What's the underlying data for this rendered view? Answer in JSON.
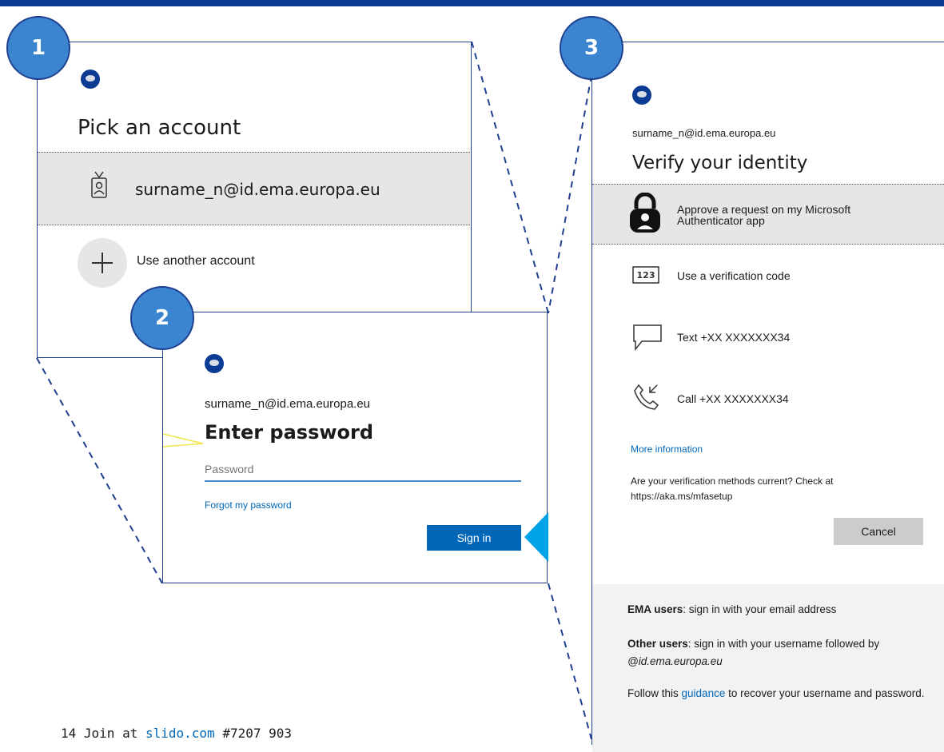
{
  "colors": {
    "brand": "#0b3b93",
    "badge": "#3b84cf",
    "link": "#0067b8",
    "accent": "#00a2e8"
  },
  "badges": [
    "1",
    "2",
    "3"
  ],
  "pick_account": {
    "title": "Pick an account",
    "account_email": "surname_n@id.ema.europa.eu",
    "use_another": "Use another account",
    "icons": {
      "account": "id-badge-icon",
      "add": "plus-icon"
    }
  },
  "enter_password": {
    "email": "surname_n@id.ema.europa.eu",
    "title": "Enter password",
    "password_placeholder": "Password",
    "forgot_link": "Forgot my password",
    "sign_in": "Sign in"
  },
  "verify_identity": {
    "email": "surname_n@id.ema.europa.eu",
    "title": "Verify your identity",
    "options": [
      {
        "icon": "lock-icon",
        "label": "Approve a request on my Microsoft Authenticator app",
        "selected": true
      },
      {
        "icon": "code-123-icon",
        "label": "Use a verification code"
      },
      {
        "icon": "chat-bubble-icon",
        "label": "Text +XX XXXXXXX34"
      },
      {
        "icon": "phone-call-icon",
        "label": "Call +XX XXXXXXX34"
      }
    ],
    "more_info": "More information",
    "methods_current": "Are your verification methods current? Check at https://aka.ms/mfasetup",
    "cancel": "Cancel",
    "info": {
      "ema_label": "EMA users",
      "ema_text": ": sign in with your email address",
      "other_label": "Other users",
      "other_text": ": sign in with your username followed by",
      "other_domain": "@id.ema.europa.eu",
      "follow_pre": "Follow this ",
      "guidance": "guidance",
      "follow_post": " to recover your username and password."
    }
  },
  "footer": {
    "page_number": "14",
    "join_pre": "Join at ",
    "join_link": "slido.com",
    "join_code": "#7207 903"
  }
}
